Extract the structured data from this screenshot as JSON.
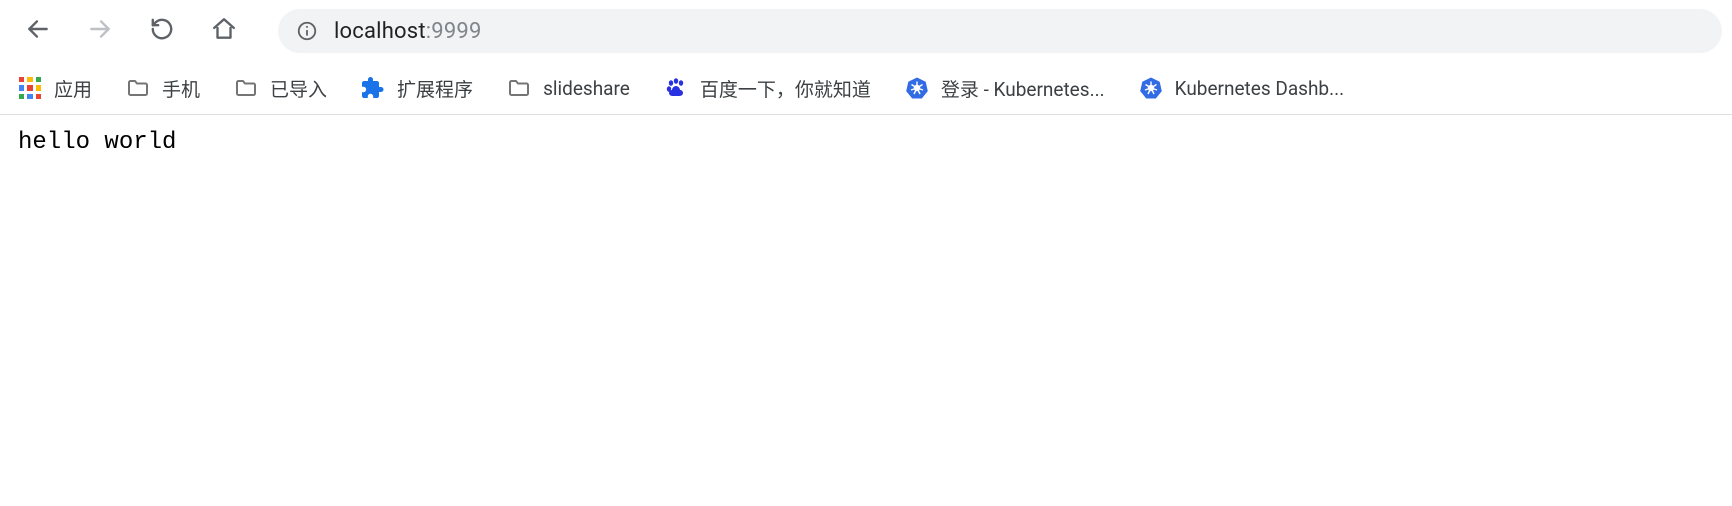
{
  "address": {
    "host": "localhost",
    "port": ":9999"
  },
  "bookmarks": [
    {
      "label": "应用"
    },
    {
      "label": "手机"
    },
    {
      "label": "已导入"
    },
    {
      "label": "扩展程序"
    },
    {
      "label": "slideshare"
    },
    {
      "label": "百度一下，你就知道"
    },
    {
      "label": "登录 - Kubernetes..."
    },
    {
      "label": "Kubernetes Dashb..."
    }
  ],
  "page": {
    "body_text": "hello world"
  },
  "colors": {
    "apps_grid": [
      "#ea4335",
      "#fbbc05",
      "#34a853",
      "#4285f4",
      "#ea4335",
      "#fbbc05",
      "#34a853",
      "#4285f4",
      "#ea4335"
    ],
    "k8s_blue": "#326ce5",
    "baidu_blue": "#2932e1",
    "ext_blue": "#1a73e8",
    "folder_gray": "#757575"
  }
}
